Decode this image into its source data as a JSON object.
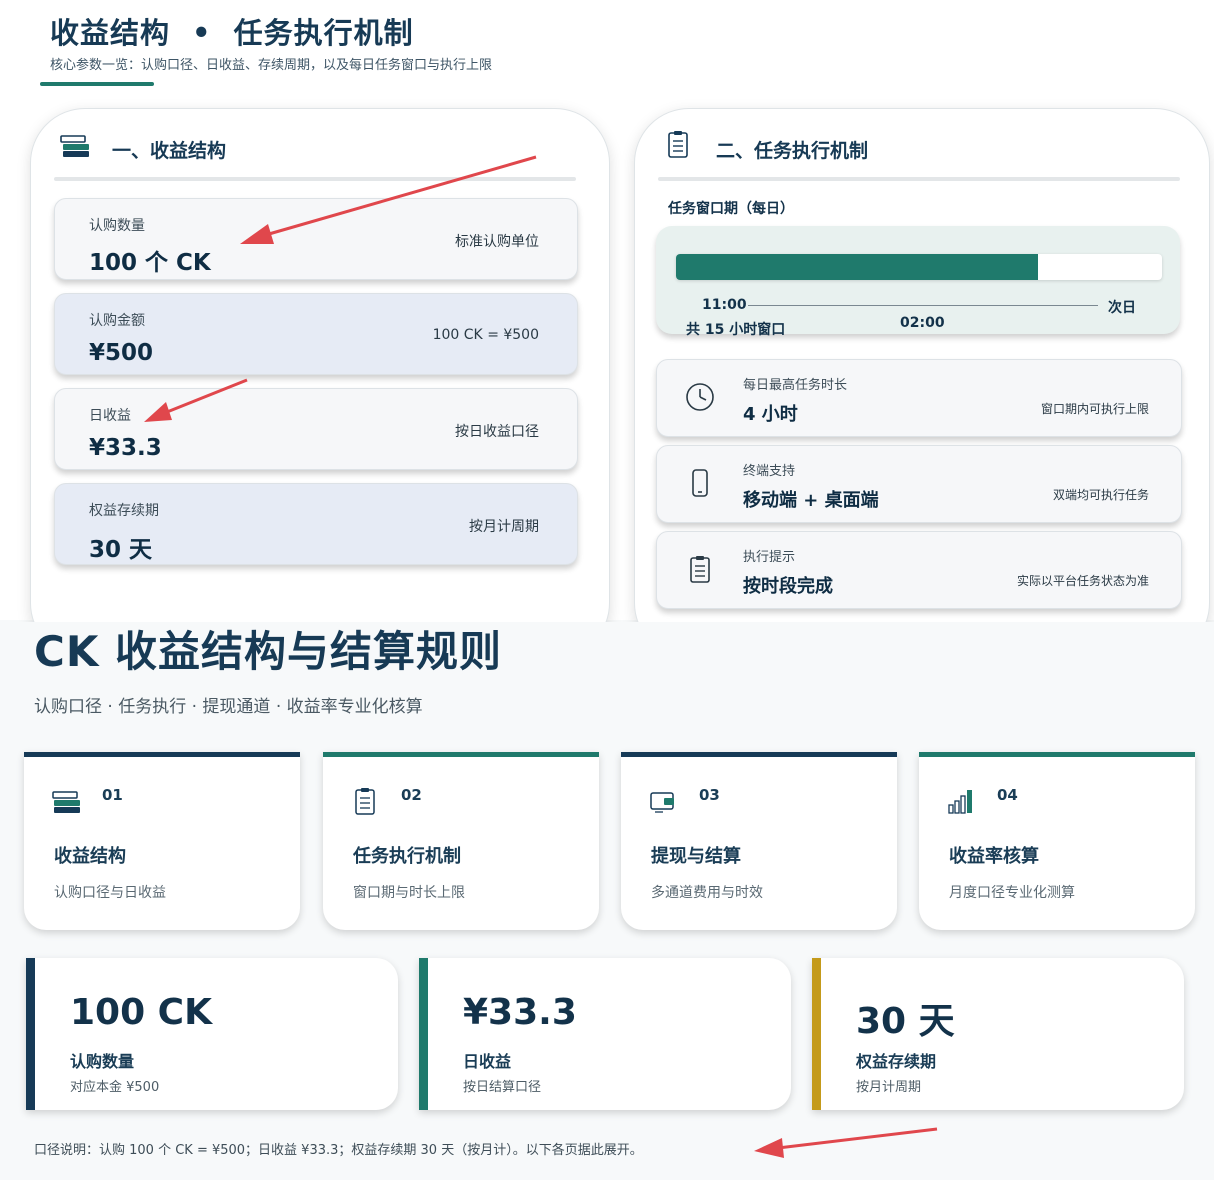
{
  "top": {
    "title_a": "收益结构",
    "title_sep": "•",
    "title_b": "任务执行机制",
    "subtitle": "核心参数一览：认购口径、日收益、存续周期，以及每日任务窗口与执行上限"
  },
  "income_panel": {
    "heading": "一、收益结构",
    "rows": [
      {
        "label": "认购数量",
        "value": "100 个 CK",
        "note": "标准认购单位"
      },
      {
        "label": "认购金额",
        "value": "¥500",
        "note": "100 CK = ¥500"
      },
      {
        "label": "日收益",
        "value": "¥33.3",
        "note": "按日收益口径"
      },
      {
        "label": "权益存续期",
        "value": "30 天",
        "note": "按月计周期"
      }
    ]
  },
  "task_panel": {
    "heading": "二、任务执行机制",
    "window_label": "任务窗口期（每日）",
    "timeline": {
      "fill_fraction": 0.745,
      "start": "11:00",
      "next_day": "次日",
      "end": "02:00",
      "total": "共 15 小时窗口"
    },
    "rows": [
      {
        "icon": "clock-icon",
        "label": "每日最高任务时长",
        "value": "4 小时",
        "note": "窗口期内可执行上限"
      },
      {
        "icon": "phone-icon",
        "label": "终端支持",
        "value": "移动端 + 桌面端",
        "note": "双端均可执行任务"
      },
      {
        "icon": "checklist-icon",
        "label": "执行提示",
        "value": "按时段完成",
        "note": "实际以平台任务状态为准"
      }
    ]
  },
  "main": {
    "title": "CK 收益结构与结算规则",
    "subtitle": "认购口径 · 任务执行 · 提现通道 · 收益率专业化核算"
  },
  "nav_cards": [
    {
      "num": "01",
      "title": "收益结构",
      "desc": "认购口径与日收益",
      "icon": "stack-icon",
      "color": "#163a57"
    },
    {
      "num": "02",
      "title": "任务执行机制",
      "desc": "窗口期与时长上限",
      "icon": "checklist-icon",
      "color": "#1f7a6c"
    },
    {
      "num": "03",
      "title": "提现与结算",
      "desc": "多通道费用与时效",
      "icon": "wallet-icon",
      "color": "#163a57"
    },
    {
      "num": "04",
      "title": "收益率核算",
      "desc": "月度口径专业化测算",
      "icon": "bar-chart-icon",
      "color": "#1f7a6c"
    }
  ],
  "stats": [
    {
      "value": "100 CK",
      "label": "认购数量",
      "sub": "对应本金 ¥500",
      "color": "#163a57"
    },
    {
      "value": "¥33.3",
      "label": "日收益",
      "sub": "按日结算口径",
      "color": "#1f7a6c"
    },
    {
      "value": "30 天",
      "label": "权益存续期",
      "sub": "按月计周期",
      "color": "#c49a1a"
    }
  ],
  "footnote": "口径说明：认购 100 个 CK = ¥500；日收益 ¥33.3；权益存续期 30 天（按月计）。以下各页据此展开。",
  "colors": {
    "navy": "#163a57",
    "teal": "#1f7a6c",
    "gold": "#c49a1a",
    "arrow": "#e0474c"
  }
}
